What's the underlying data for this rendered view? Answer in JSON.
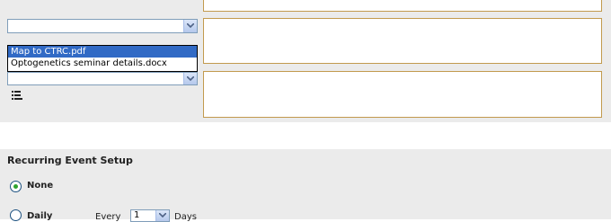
{
  "attachments": {
    "dropdown_options": [
      "Map to CTRC.pdf",
      "Optogenetics seminar details.docx"
    ],
    "selected_index": 0
  },
  "recurring": {
    "title": "Recurring Event Setup",
    "options": [
      {
        "label": "None",
        "checked": true
      },
      {
        "label": "Daily",
        "checked": false
      }
    ],
    "every_label": "Every",
    "every_value": "1",
    "unit_label": "Days"
  },
  "colors": {
    "panel_bg": "#ebebeb",
    "textbox_border": "#c29a4e",
    "selected_option_bg": "#316ac5",
    "radio_dot": "#2fa32f"
  },
  "icons": {
    "dropdown_arrow": "chevron-down-icon",
    "list": "list-icon"
  }
}
